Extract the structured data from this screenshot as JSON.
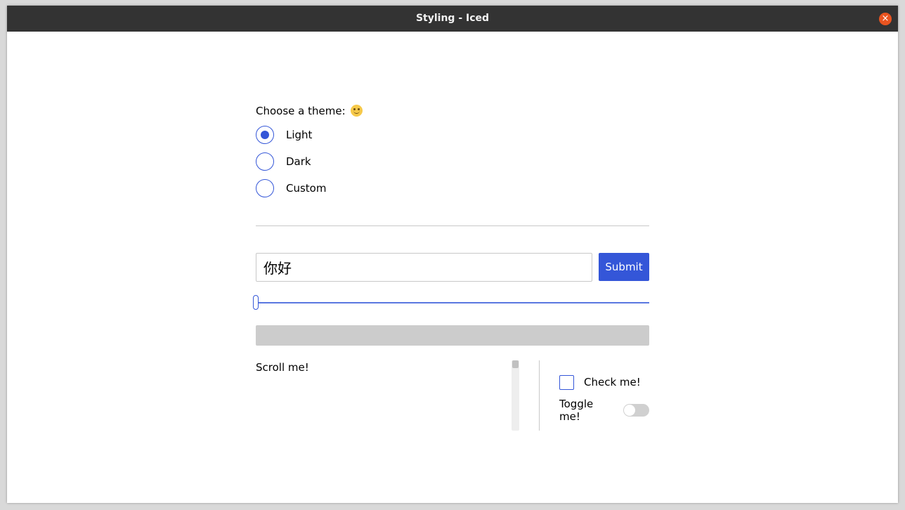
{
  "window": {
    "title": "Styling - Iced",
    "close_icon": "close-icon"
  },
  "theme": {
    "label": "Choose a theme:",
    "emoji_icon": "smiling-face-icon",
    "options": [
      {
        "label": "Light",
        "checked": true
      },
      {
        "label": "Dark",
        "checked": false
      },
      {
        "label": "Custom",
        "checked": false
      }
    ]
  },
  "form": {
    "input_value": "你好",
    "submit_label": "Submit"
  },
  "slider": {
    "value": 0
  },
  "progress": {
    "value": 0
  },
  "scrollable": {
    "text": "Scroll me!"
  },
  "checkbox": {
    "label": "Check me!",
    "checked": false
  },
  "toggler": {
    "label": "Toggle me!",
    "on": false
  },
  "colors": {
    "accent": "#3456d8",
    "titlebar": "#333333",
    "close_button": "#e95420",
    "progress_track": "#cccccc"
  }
}
